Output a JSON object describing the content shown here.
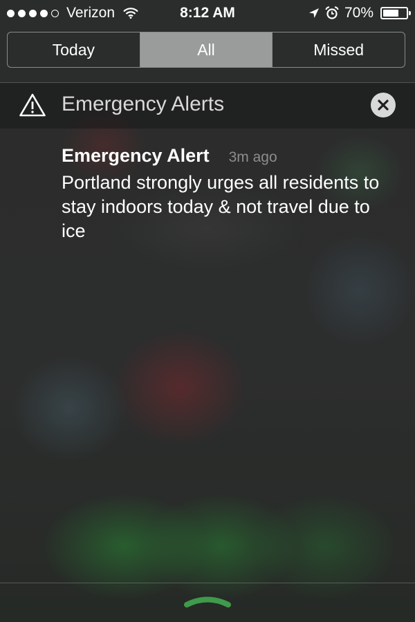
{
  "status_bar": {
    "signal_bars_filled": 4,
    "signal_bars_total": 5,
    "carrier": "Verizon",
    "time": "8:12 AM",
    "battery_percent_label": "70%",
    "battery_level": 0.7,
    "icons": [
      "wifi-icon",
      "location-arrow-icon",
      "alarm-clock-icon",
      "battery-icon"
    ]
  },
  "tabs": [
    {
      "label": "Today",
      "selected": false
    },
    {
      "label": "All",
      "selected": true
    },
    {
      "label": "Missed",
      "selected": false
    }
  ],
  "section": {
    "title": "Emergency Alerts",
    "icon": "warning-triangle-icon",
    "close_icon": "close-icon"
  },
  "notification": {
    "title": "Emergency Alert",
    "time": "3m ago",
    "body": "Portland strongly urges all residents to stay indoors today & not travel due to ice"
  },
  "footer": {
    "icon": "grabber-handle-icon",
    "accent_color": "#3f9a4c"
  },
  "colors": {
    "segment_selected_bg": "#9a9c9b",
    "close_button_bg": "#d8d8d8",
    "timestamp_text": "#8c8d8d"
  }
}
